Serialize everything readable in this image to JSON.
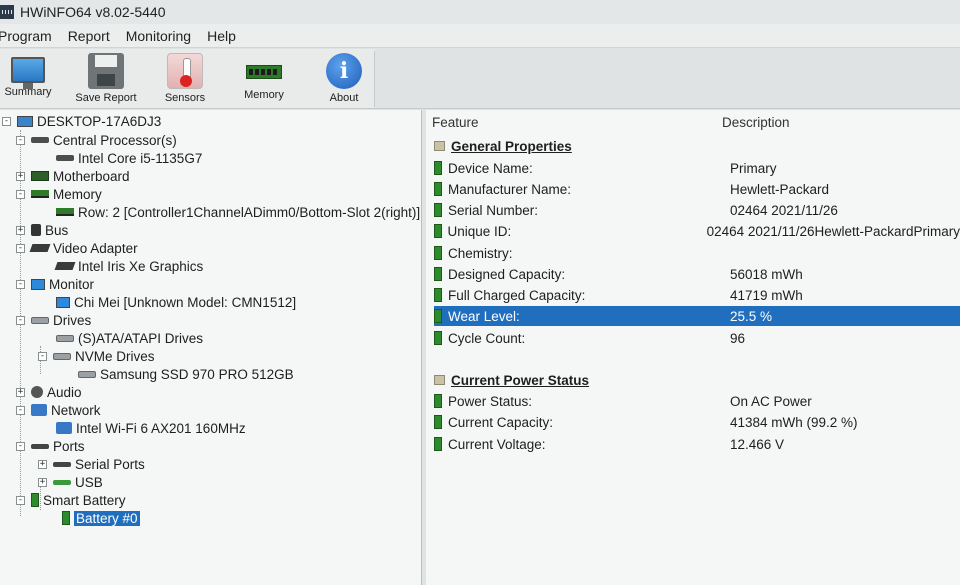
{
  "window": {
    "title": "HWiNFO64 v8.02-5440"
  },
  "menu": [
    "Program",
    "Report",
    "Monitoring",
    "Help"
  ],
  "toolbar": [
    {
      "label": "Summary",
      "icon": "summary-monitor-icon"
    },
    {
      "label": "Save Report",
      "icon": "floppy-disk-icon"
    },
    {
      "label": "Sensors",
      "icon": "thermometer-icon"
    },
    {
      "label": "Memory",
      "icon": "memory-module-icon"
    },
    {
      "label": "About",
      "icon": "info-icon"
    }
  ],
  "tree": [
    {
      "label": "DESKTOP-17A6DJ3",
      "level": 0,
      "expander": "-",
      "icon": "computer-icon"
    },
    {
      "label": "Central Processor(s)",
      "level": 1,
      "expander": "-",
      "icon": "cpu-icon"
    },
    {
      "label": "Intel Core i5-1135G7",
      "level": 2,
      "expander": "",
      "icon": "cpu-icon"
    },
    {
      "label": "Motherboard",
      "level": 1,
      "expander": "+",
      "icon": "motherboard-icon"
    },
    {
      "label": "Memory",
      "level": 1,
      "expander": "-",
      "icon": "memory-icon"
    },
    {
      "label": "Row: 2 [Controller1ChannelADimm0/Bottom-Slot 2(right)]",
      "level": 2,
      "expander": "",
      "icon": "memory-icon"
    },
    {
      "label": "Bus",
      "level": 1,
      "expander": "+",
      "icon": "bus-icon"
    },
    {
      "label": "Video Adapter",
      "level": 1,
      "expander": "-",
      "icon": "graphics-card-icon"
    },
    {
      "label": "Intel Iris Xe Graphics",
      "level": 2,
      "expander": "",
      "icon": "graphics-card-icon"
    },
    {
      "label": "Monitor",
      "level": 1,
      "expander": "-",
      "icon": "monitor-icon"
    },
    {
      "label": "Chi Mei [Unknown Model: CMN1512]",
      "level": 2,
      "expander": "",
      "icon": "monitor-icon"
    },
    {
      "label": "Drives",
      "level": 1,
      "expander": "-",
      "icon": "drive-icon"
    },
    {
      "label": "(S)ATA/ATAPI Drives",
      "level": 2,
      "expander": "",
      "icon": "drive-icon"
    },
    {
      "label": "NVMe Drives",
      "level": 2,
      "expander": "-",
      "icon": "drive-icon"
    },
    {
      "label": "Samsung SSD 970 PRO 512GB",
      "level": 3,
      "expander": "",
      "icon": "drive-icon"
    },
    {
      "label": "Audio",
      "level": 1,
      "expander": "+",
      "icon": "audio-icon"
    },
    {
      "label": "Network",
      "level": 1,
      "expander": "-",
      "icon": "network-icon"
    },
    {
      "label": "Intel Wi-Fi 6 AX201 160MHz",
      "level": 2,
      "expander": "",
      "icon": "network-icon"
    },
    {
      "label": "Ports",
      "level": 1,
      "expander": "-",
      "icon": "port-icon"
    },
    {
      "label": "Serial Ports",
      "level": 2,
      "expander": "+",
      "icon": "serial-port-icon"
    },
    {
      "label": "USB",
      "level": 2,
      "expander": "+",
      "icon": "usb-icon"
    },
    {
      "label": "Smart Battery",
      "level": 1,
      "expander": "-",
      "icon": "battery-icon"
    },
    {
      "label": "Battery #0",
      "level": 2,
      "expander": "",
      "icon": "battery-icon",
      "selected": true
    }
  ],
  "details": {
    "columns": {
      "feature": "Feature",
      "description": "Description"
    },
    "sections": [
      {
        "title": "General Properties",
        "rows": [
          {
            "feature": "Device Name:",
            "value": "Primary"
          },
          {
            "feature": "Manufacturer Name:",
            "value": "Hewlett-Packard"
          },
          {
            "feature": "Serial Number:",
            "value": "02464 2021/11/26"
          },
          {
            "feature": "Unique ID:",
            "value": "02464 2021/11/26Hewlett-PackardPrimary"
          },
          {
            "feature": "Chemistry:",
            "value": ""
          },
          {
            "feature": "Designed Capacity:",
            "value": "56018 mWh"
          },
          {
            "feature": "Full Charged Capacity:",
            "value": "41719 mWh"
          },
          {
            "feature": "Wear Level:",
            "value": "25.5 %",
            "selected": true
          },
          {
            "feature": "Cycle Count:",
            "value": "96"
          }
        ]
      },
      {
        "title": "Current Power Status",
        "rows": [
          {
            "feature": "Power Status:",
            "value": "On AC Power"
          },
          {
            "feature": "Current Capacity:",
            "value": "41384 mWh (99.2 %)"
          },
          {
            "feature": "Current Voltage:",
            "value": "12.466 V"
          }
        ]
      }
    ]
  },
  "colors": {
    "selection": "#1f6fbe",
    "pane_bg": "#f5f6f6",
    "property_icon": "#2d8a2d"
  }
}
